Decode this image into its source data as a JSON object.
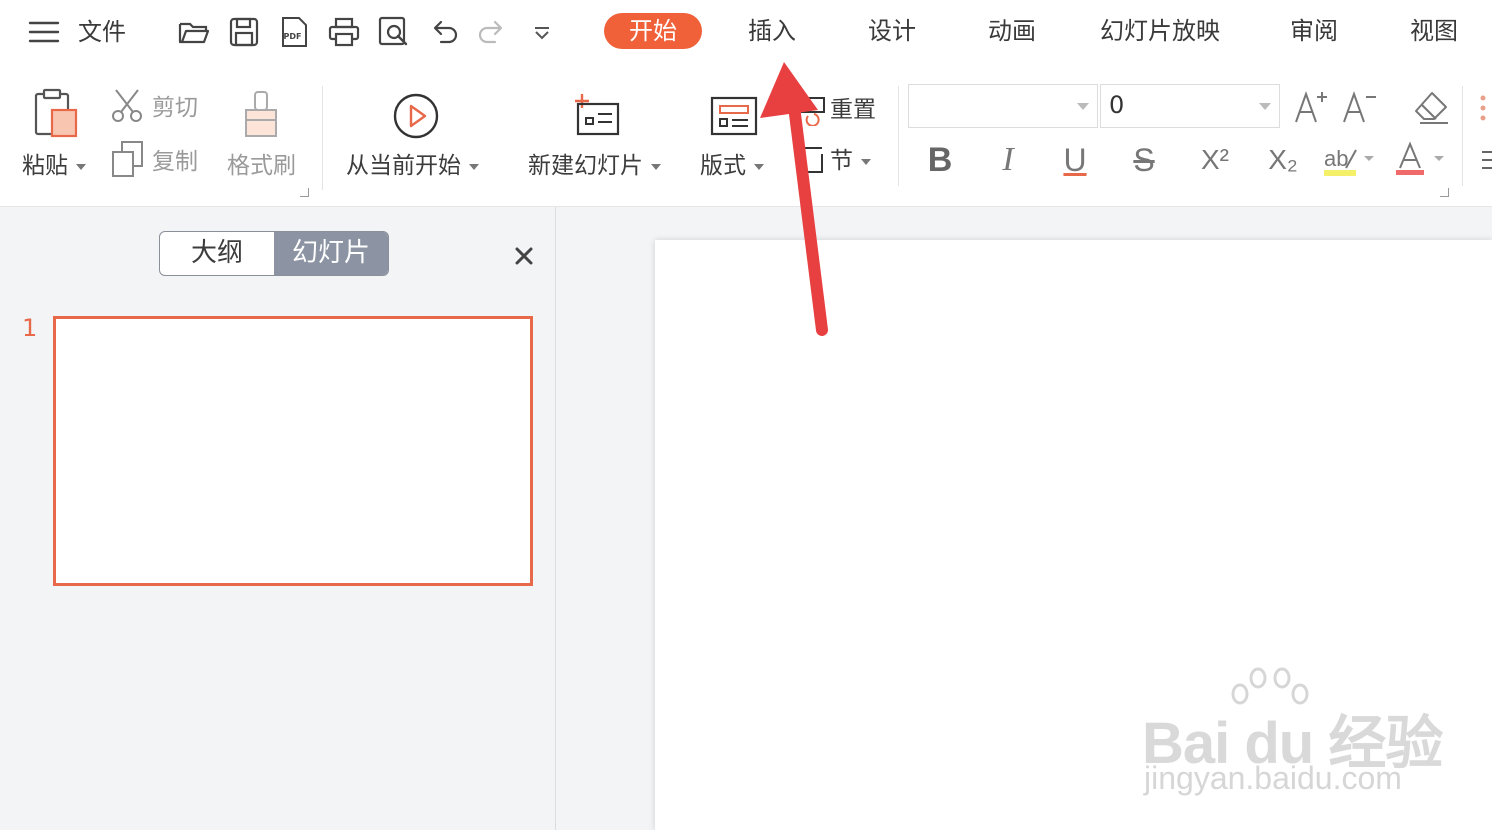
{
  "menu": {
    "hamburger_icon": "menu-icon",
    "file_label": "文件",
    "quick_access": [
      "open-folder-icon",
      "save-icon",
      "export-pdf-icon",
      "print-icon",
      "print-preview-icon",
      "undo-icon",
      "redo-icon",
      "customize-dropdown-icon"
    ]
  },
  "tabs": [
    {
      "label": "开始",
      "active": true
    },
    {
      "label": "插入"
    },
    {
      "label": "设计"
    },
    {
      "label": "动画"
    },
    {
      "label": "幻灯片放映"
    },
    {
      "label": "审阅"
    },
    {
      "label": "视图"
    }
  ],
  "ribbon": {
    "paste": "粘贴",
    "cut": "剪切",
    "copy": "复制",
    "format_painter": "格式刷",
    "from_current": "从当前开始",
    "new_slide": "新建幻灯片",
    "layout": "版式",
    "reset": "重置",
    "section": "节",
    "font_name": "",
    "font_size": "0",
    "bold": "B",
    "italic": "I",
    "underline": "U",
    "strike": "S",
    "superscript": "X²",
    "subscript": "X₂",
    "grow_font": "A⁺",
    "shrink_font": "A⁻"
  },
  "panel": {
    "outline_tab": "大纲",
    "slides_tab": "幻灯片",
    "close": "×",
    "slide_number": "1"
  },
  "watermark": {
    "brand": "Bai du 经验",
    "url": "jingyan.baidu.com"
  },
  "colors": {
    "accent": "#f0613a",
    "arrow": "#e84040",
    "thumb_border": "#e8684a"
  }
}
